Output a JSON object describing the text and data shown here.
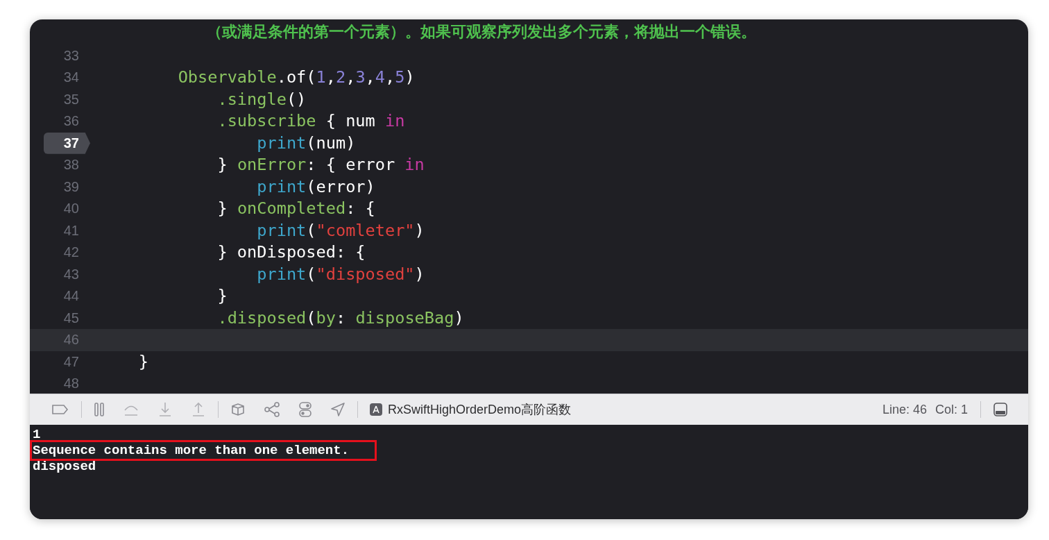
{
  "editor": {
    "lines": [
      {
        "tokens": [
          {
            "text": "            （或满足条件的第一个元素）。如果可观察序列发出多个元素，将抛出一个错误。",
            "kind": "comment"
          }
        ]
      },
      {
        "number": "33",
        "current": false
      },
      {
        "number": "34",
        "current": false,
        "tokens": [
          {
            "text": "        Observable",
            "kind": "green"
          },
          {
            "text": ".of(",
            "kind": "plain"
          },
          {
            "text": "1",
            "kind": "number"
          },
          {
            "text": ",",
            "kind": "plain"
          },
          {
            "text": "2",
            "kind": "number"
          },
          {
            "text": ",",
            "kind": "plain"
          },
          {
            "text": "3",
            "kind": "number"
          },
          {
            "text": ",",
            "kind": "plain"
          },
          {
            "text": "4",
            "kind": "number"
          },
          {
            "text": ",",
            "kind": "plain"
          },
          {
            "text": "5",
            "kind": "number"
          },
          {
            "text": ")",
            "kind": "plain"
          }
        ]
      },
      {
        "number": "35",
        "current": false,
        "tokens": [
          {
            "text": "            .single",
            "kind": "green"
          },
          {
            "text": "()",
            "kind": "plain"
          }
        ]
      },
      {
        "number": "36",
        "current": false,
        "tokens": [
          {
            "text": "            .subscribe",
            "kind": "green"
          },
          {
            "text": " { num ",
            "kind": "plain"
          },
          {
            "text": "in",
            "kind": "keyword"
          }
        ]
      },
      {
        "number": "37",
        "current": true,
        "tokens": [
          {
            "text": "                print",
            "kind": "func"
          },
          {
            "text": "(num)",
            "kind": "plain"
          }
        ]
      },
      {
        "number": "38",
        "current": false,
        "tokens": [
          {
            "text": "            } ",
            "kind": "plain"
          },
          {
            "text": "onError",
            "kind": "green"
          },
          {
            "text": ": { error ",
            "kind": "plain"
          },
          {
            "text": "in",
            "kind": "keyword"
          }
        ]
      },
      {
        "number": "39",
        "current": false,
        "tokens": [
          {
            "text": "                print",
            "kind": "func"
          },
          {
            "text": "(error)",
            "kind": "plain"
          }
        ]
      },
      {
        "number": "40",
        "current": false,
        "tokens": [
          {
            "text": "            } ",
            "kind": "plain"
          },
          {
            "text": "onCompleted",
            "kind": "green"
          },
          {
            "text": ": {",
            "kind": "plain"
          }
        ]
      },
      {
        "number": "41",
        "current": false,
        "tokens": [
          {
            "text": "                print",
            "kind": "func"
          },
          {
            "text": "(",
            "kind": "plain"
          },
          {
            "text": "\"comleter\"",
            "kind": "string"
          },
          {
            "text": ")",
            "kind": "plain"
          }
        ]
      },
      {
        "number": "42",
        "current": false,
        "tokens": [
          {
            "text": "            } onDisposed: {",
            "kind": "plain"
          }
        ]
      },
      {
        "number": "43",
        "current": false,
        "tokens": [
          {
            "text": "                print",
            "kind": "func"
          },
          {
            "text": "(",
            "kind": "plain"
          },
          {
            "text": "\"disposed\"",
            "kind": "string"
          },
          {
            "text": ")",
            "kind": "plain"
          }
        ]
      },
      {
        "number": "44",
        "current": false,
        "tokens": [
          {
            "text": "            }",
            "kind": "plain"
          }
        ]
      },
      {
        "number": "45",
        "current": false,
        "tokens": [
          {
            "text": "            .disposed",
            "kind": "green"
          },
          {
            "text": "(",
            "kind": "plain"
          },
          {
            "text": "by",
            "kind": "green"
          },
          {
            "text": ": ",
            "kind": "plain"
          },
          {
            "text": "disposeBag",
            "kind": "green"
          },
          {
            "text": ")",
            "kind": "plain"
          }
        ]
      },
      {
        "number": "46",
        "current": false,
        "highlighted": true
      },
      {
        "number": "47",
        "current": false,
        "tokens": [
          {
            "text": "    }",
            "kind": "plain"
          }
        ]
      },
      {
        "number": "48",
        "current": false
      }
    ]
  },
  "debug_bar": {
    "scheme": "RxSwiftHighOrderDemo高阶函数",
    "line": "Line: 46",
    "col": "Col: 1"
  },
  "console": [
    {
      "text": "1",
      "highlighted": false
    },
    {
      "text": "Sequence contains more than one element.",
      "highlighted": true
    },
    {
      "text": "disposed",
      "highlighted": false
    }
  ]
}
